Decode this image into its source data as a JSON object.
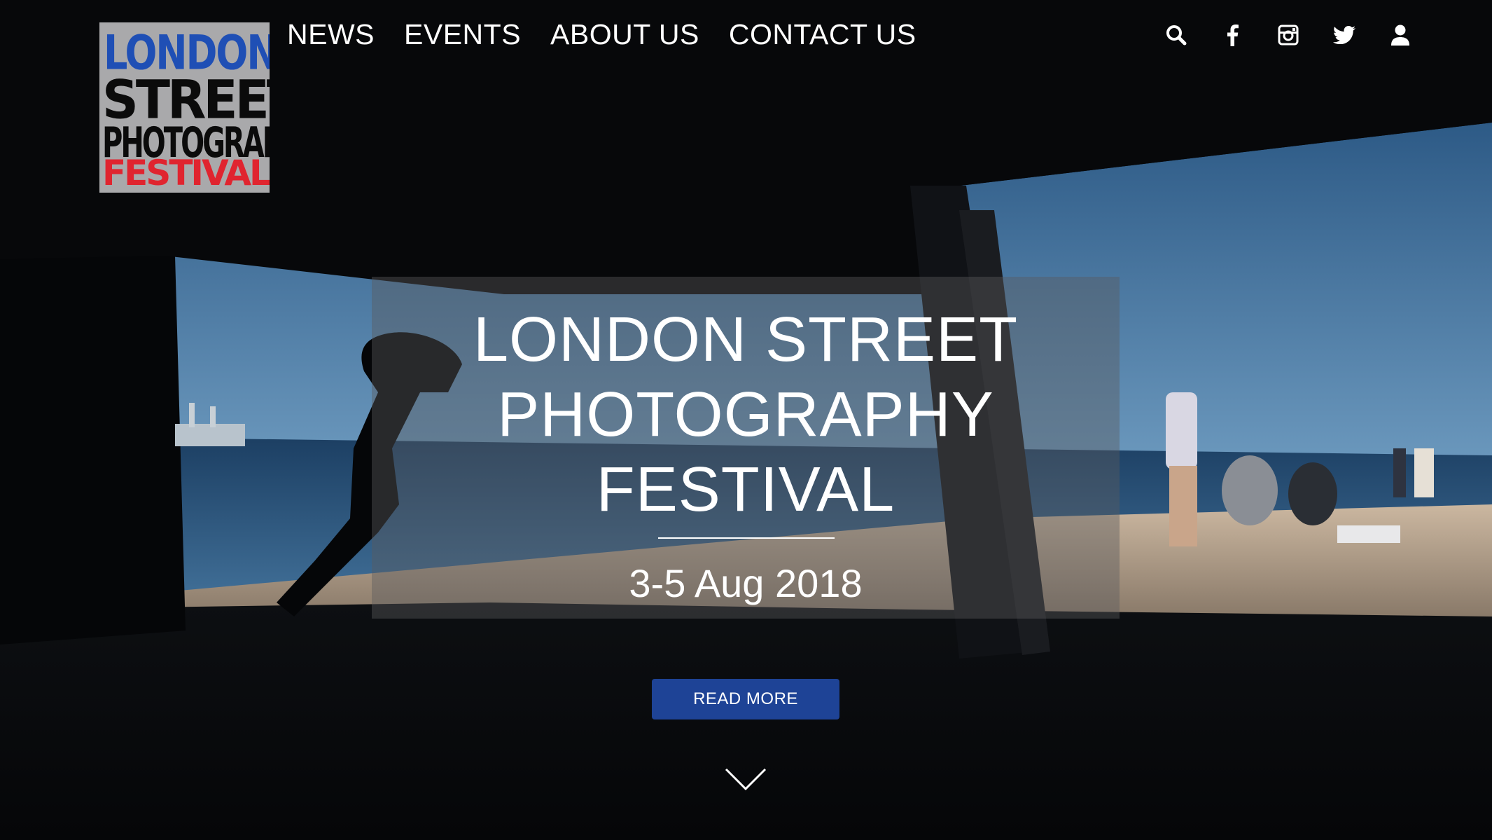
{
  "logo": {
    "line1": "LONDON",
    "line2": "STREET",
    "line3": "PHOTOGRAPHY",
    "line4": "FESTIVAL"
  },
  "nav": {
    "items": [
      "NEWS",
      "EVENTS",
      "ABOUT US",
      "CONTACT US"
    ]
  },
  "header_icons": [
    "search-icon",
    "facebook-icon",
    "instagram-icon",
    "twitter-icon",
    "user-icon"
  ],
  "hero": {
    "title_lines": [
      "LONDON STREET",
      "PHOTOGRAPHY",
      "FESTIVAL"
    ],
    "dates": "3-5 Aug 2018",
    "button_label": "READ MORE"
  },
  "colors": {
    "button": "#1e4396",
    "logo_blue": "#1f4fb5",
    "logo_red": "#e0242f",
    "logo_bg": "#a9a9ab"
  }
}
